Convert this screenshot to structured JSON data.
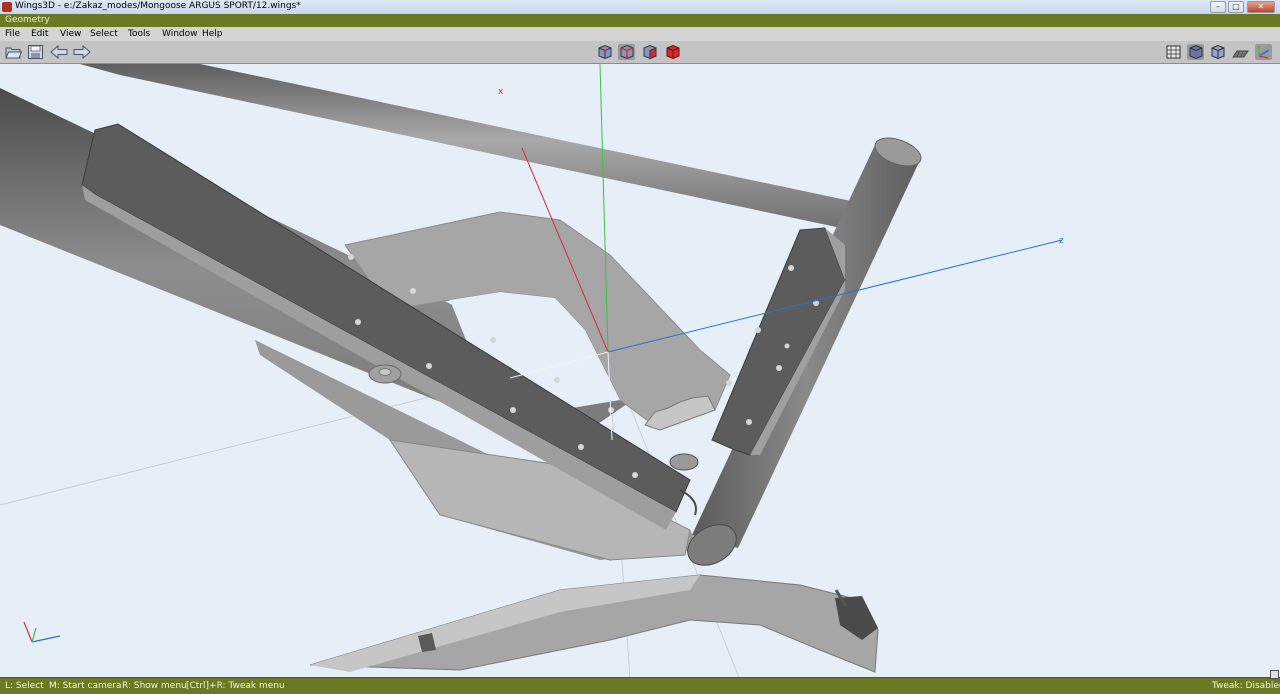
{
  "window": {
    "title": "Wings3D - e:/Zakaz_modes/Mongoose ARGUS SPORT/12.wings*",
    "minimize": "–",
    "maximize": "□",
    "close": "✕"
  },
  "geometry_bar": {
    "label": "Geometry"
  },
  "menu": {
    "file": "File",
    "edit": "Edit",
    "view": "View",
    "select": "Select",
    "tools": "Tools",
    "window": "Window",
    "help": "Help"
  },
  "toolbar": {
    "left_icons": [
      "open-folder-icon",
      "save-disk-icon",
      "undo-arrow-icon",
      "redo-arrow-icon"
    ],
    "selection_mode_icons": [
      "vertex-mode-icon",
      "edge-mode-icon",
      "face-mode-icon",
      "body-mode-icon"
    ],
    "right_icons": [
      "wireframe-toggle-icon",
      "smooth-shade-icon",
      "flat-shade-icon",
      "groundplane-icon",
      "axes-toggle-icon"
    ],
    "body_mode_color": "#d42a2a"
  },
  "viewport": {
    "axis_labels": {
      "x": "x",
      "z": "z"
    },
    "axis_colors": {
      "x": "#d03040",
      "y": "#40c040",
      "z": "#2f6fd0"
    },
    "model_description_icon": "bicycle-frame-model"
  },
  "status": {
    "l_hint": "L: Select",
    "m_hint": "M: Start camera",
    "r_hint": "R: Show menu",
    "ctrl_hint": "[Ctrl]+R: Tweak menu",
    "tweak": "Tweak: Disabled"
  },
  "colors": {
    "status_bar": "#6b7a22",
    "viewport_bg": "#e6eef8"
  }
}
